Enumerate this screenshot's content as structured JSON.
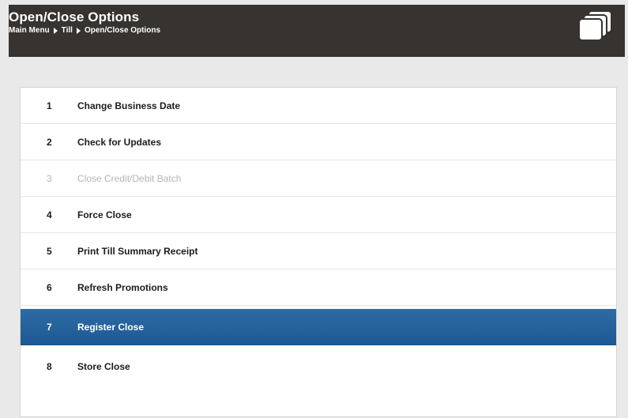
{
  "header": {
    "title": "Open/Close Options",
    "breadcrumb": [
      "Main Menu",
      "Till",
      "Open/Close Options"
    ],
    "window_icon": "windows-icon"
  },
  "menu": {
    "items": [
      {
        "number": "1",
        "label": "Change Business Date",
        "state": "enabled"
      },
      {
        "number": "2",
        "label": "Check for Updates",
        "state": "enabled"
      },
      {
        "number": "3",
        "label": "Close Credit/Debit Batch",
        "state": "disabled"
      },
      {
        "number": "4",
        "label": "Force Close",
        "state": "enabled"
      },
      {
        "number": "5",
        "label": "Print Till Summary Receipt",
        "state": "enabled"
      },
      {
        "number": "6",
        "label": "Refresh Promotions",
        "state": "enabled"
      },
      {
        "number": "7",
        "label": "Register Close",
        "state": "selected"
      },
      {
        "number": "8",
        "label": "Store Close",
        "state": "enabled"
      }
    ]
  },
  "colors": {
    "header_bg": "#363330",
    "selected_bg": "#1d5a95",
    "disabled_text": "#b5b5b5"
  }
}
